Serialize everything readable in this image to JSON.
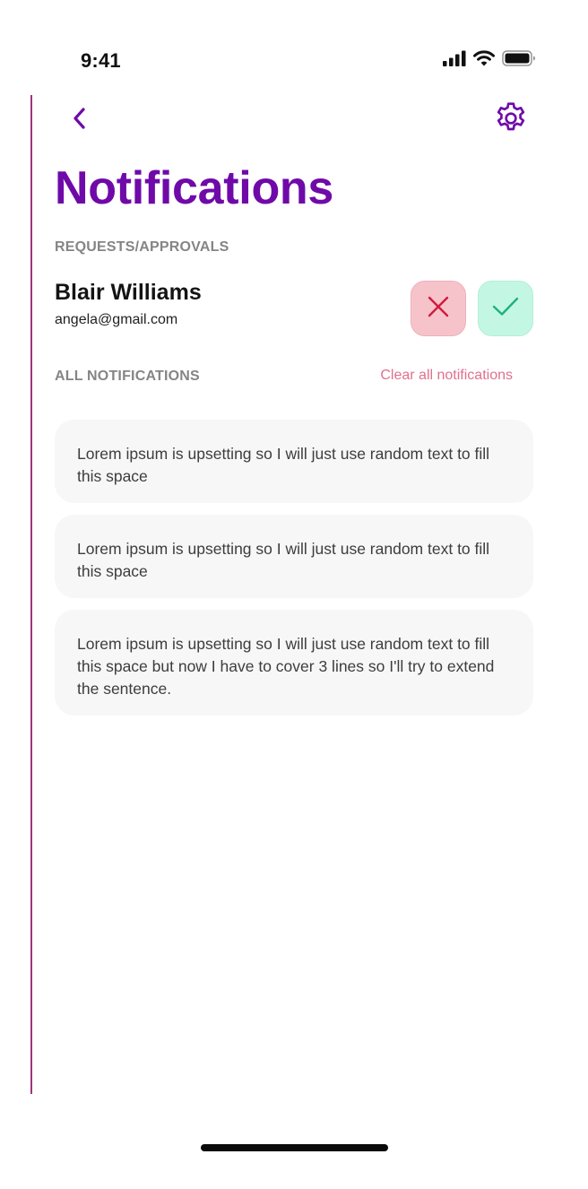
{
  "status_bar": {
    "time": "9:41",
    "signal_icon": "cellular-signal-icon",
    "wifi_icon": "wifi-icon",
    "battery_icon": "battery-icon"
  },
  "header": {
    "back_icon": "chevron-left-icon",
    "settings_icon": "gear-icon",
    "title": "Notifications"
  },
  "requests": {
    "section_label": "REQUESTS/APPROVALS",
    "items": [
      {
        "name": "Blair Williams",
        "email": "angela@gmail.com",
        "reject_icon": "close-icon",
        "approve_icon": "check-icon"
      }
    ]
  },
  "notifications": {
    "section_label": "ALL NOTIFICATIONS",
    "clear_label": "Clear all notifications",
    "items": [
      {
        "text": "Lorem ipsum is upsetting so I will just use random text to fill this space"
      },
      {
        "text": "Lorem ipsum is upsetting so I will just use random text to fill this space"
      },
      {
        "text": "Lorem ipsum is upsetting so I will just use random text to fill this space but now I have to cover 3 lines so I'll try to extend the sentence."
      }
    ]
  },
  "colors": {
    "accent": "#6f0aa9",
    "clear_link": "#e0708e",
    "reject_bg": "#f6c3cb",
    "reject_icon": "#d11a3c",
    "approve_bg": "#c3f7e4",
    "approve_icon": "#1fb27a",
    "card_bg": "#f7f7f7"
  }
}
